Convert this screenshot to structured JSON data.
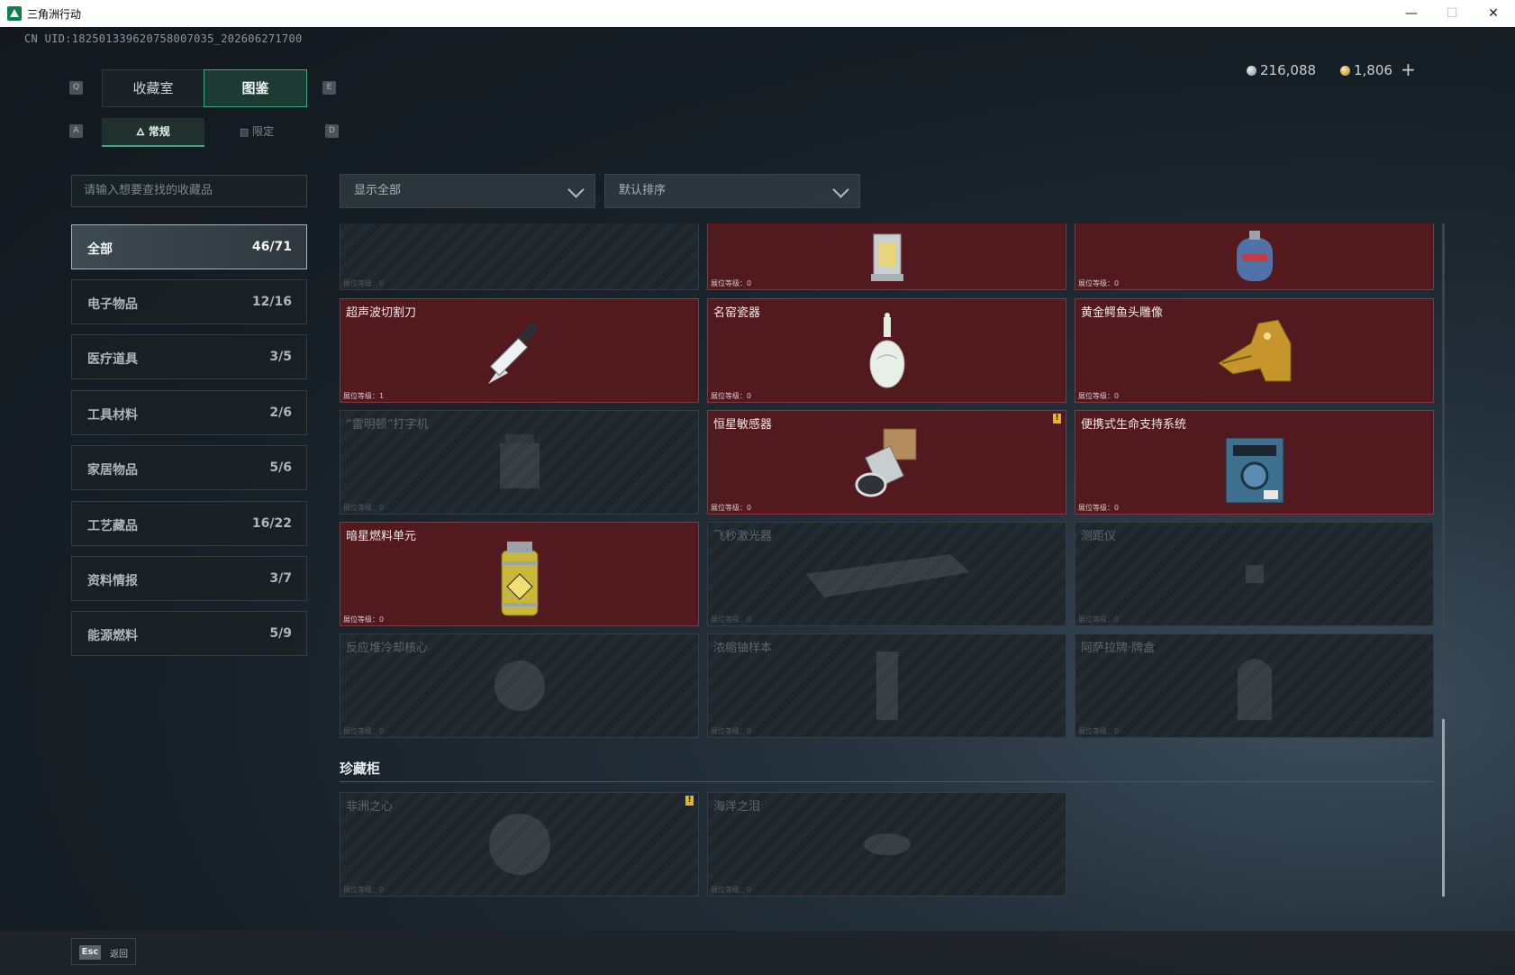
{
  "window": {
    "title": "三角洲行动",
    "minimize": "—",
    "maximize": "☐",
    "close": "✕"
  },
  "header": {
    "uid": "CN UID:182501339620758007035_202606271700",
    "currency": [
      {
        "icon": "silver-coin-icon",
        "value": "216,088"
      },
      {
        "icon": "gold-coin-icon",
        "value": "1,806"
      }
    ],
    "plus": "+"
  },
  "tabs": {
    "key_left": "Q",
    "key_right": "E",
    "items": [
      {
        "label": "收藏室"
      },
      {
        "label": "图鉴",
        "active": true
      }
    ]
  },
  "subtabs": {
    "key_left": "A",
    "key_right": "D",
    "items": [
      {
        "label": "常规",
        "icon": "flame-icon",
        "active": true
      },
      {
        "label": "限定",
        "icon": "image-icon"
      }
    ]
  },
  "search": {
    "placeholder": "请输入想要查找的收藏品"
  },
  "filters": {
    "show": "显示全部",
    "sort": "默认排序"
  },
  "categories": [
    {
      "label": "全部",
      "count": "46/71",
      "active": true
    },
    {
      "label": "电子物品",
      "count": "12/16"
    },
    {
      "label": "医疗道具",
      "count": "3/5"
    },
    {
      "label": "工具材料",
      "count": "2/6"
    },
    {
      "label": "家居物品",
      "count": "5/6"
    },
    {
      "label": "工艺藏品",
      "count": "16/22"
    },
    {
      "label": "资料情报",
      "count": "3/7"
    },
    {
      "label": "能源燃料",
      "count": "5/9"
    }
  ],
  "level_label": "展位等级：",
  "items": [
    {
      "name": "",
      "level": "0",
      "owned": false,
      "icon": "unknown-item-icon"
    },
    {
      "name": "",
      "level": "0",
      "owned": true,
      "icon": "lantern-icon"
    },
    {
      "name": "",
      "level": "0",
      "owned": true,
      "icon": "gas-tank-icon"
    },
    {
      "name": "超声波切割刀",
      "level": "1",
      "owned": true,
      "icon": "scalpel-icon"
    },
    {
      "name": "名窑瓷器",
      "level": "0",
      "owned": true,
      "icon": "porcelain-vase-icon"
    },
    {
      "name": "黄金鳄鱼头雕像",
      "level": "0",
      "owned": true,
      "icon": "gold-crocodile-icon"
    },
    {
      "name": "“雷明顿”打字机",
      "level": "0",
      "owned": false,
      "icon": "typewriter-icon"
    },
    {
      "name": "恒星敏感器",
      "level": "0",
      "owned": true,
      "icon": "star-sensor-icon",
      "warning": true
    },
    {
      "name": "便携式生命支持系统",
      "level": "0",
      "owned": true,
      "icon": "life-support-icon"
    },
    {
      "name": "暗星燃料单元",
      "level": "0",
      "owned": true,
      "icon": "fuel-cell-icon"
    },
    {
      "name": "飞秒激光器",
      "level": "0",
      "owned": false,
      "icon": "laser-icon"
    },
    {
      "name": "测距仪",
      "level": "0",
      "owned": false,
      "icon": "rangefinder-icon"
    },
    {
      "name": "反应堆冷却核心",
      "level": "0",
      "owned": false,
      "icon": "reactor-core-icon"
    },
    {
      "name": "浓缩铀样本",
      "level": "0",
      "owned": false,
      "icon": "uranium-sample-icon"
    },
    {
      "name": "阿萨拉牌·牌盒",
      "level": "0",
      "owned": false,
      "icon": "card-box-icon"
    }
  ],
  "treasure": {
    "title": "珍藏柜",
    "items": [
      {
        "name": "非洲之心",
        "level": "0",
        "owned": false,
        "icon": "diamond-icon",
        "warning": true
      },
      {
        "name": "海洋之泪",
        "level": "0",
        "owned": false,
        "icon": "gem-icon"
      }
    ]
  },
  "warning_mark": "!",
  "footer": {
    "key": "Esc",
    "label": "返回"
  }
}
